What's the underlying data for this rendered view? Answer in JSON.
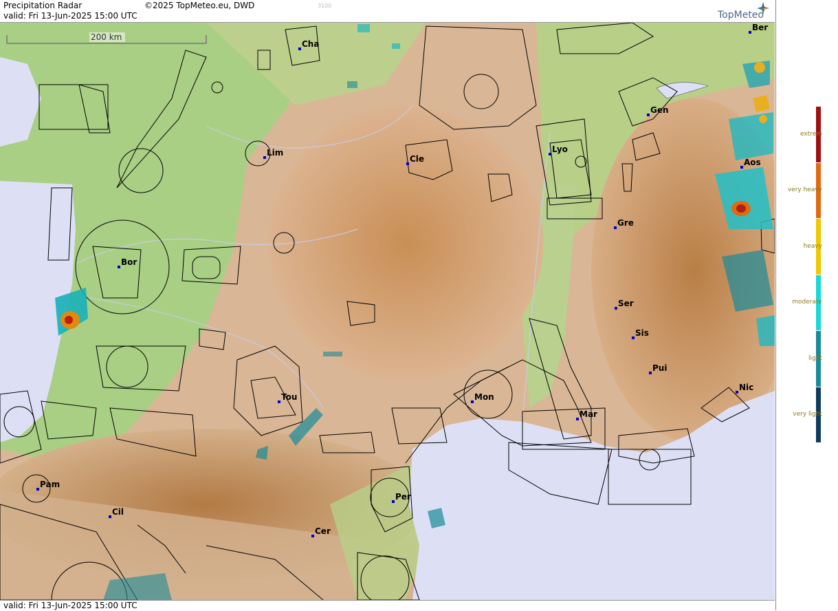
{
  "header": {
    "title": "Precipitation Radar",
    "copyright": "©2025 TopMeteo.eu, DWD",
    "valid": "valid:  Fri  13-Jun-2025 15:00 UTC",
    "faint_number": "3100",
    "brand": "TopMeteo"
  },
  "footer": {
    "valid": "valid:  Fri  13-Jun-2025 15:00 UTC"
  },
  "map": {
    "scale_label": "200 km",
    "cities": [
      "Ber",
      "Cha",
      "Gen",
      "Lim",
      "Cle",
      "Lyo",
      "Aos",
      "Gre",
      "Bor",
      "Ser",
      "Sis",
      "Pui",
      "Nic",
      "Mon",
      "Tou",
      "Mar",
      "Pam",
      "Per",
      "Cil",
      "Cer"
    ],
    "colors": {
      "sea": "#dde0f5",
      "lowland": "#a9cf84",
      "hill": "#dab493",
      "mountain": "#c9955e"
    }
  },
  "legend": {
    "classes": [
      {
        "label": "extrem",
        "color": "#a01010"
      },
      {
        "label": "very heavy",
        "color": "#e06a10"
      },
      {
        "label": "heavy",
        "color": "#f0c800"
      },
      {
        "label": "moderate",
        "color": "#18d8d8"
      },
      {
        "label": "light",
        "color": "#1a8a98"
      },
      {
        "label": "very light",
        "color": "#0e3c60"
      }
    ]
  }
}
